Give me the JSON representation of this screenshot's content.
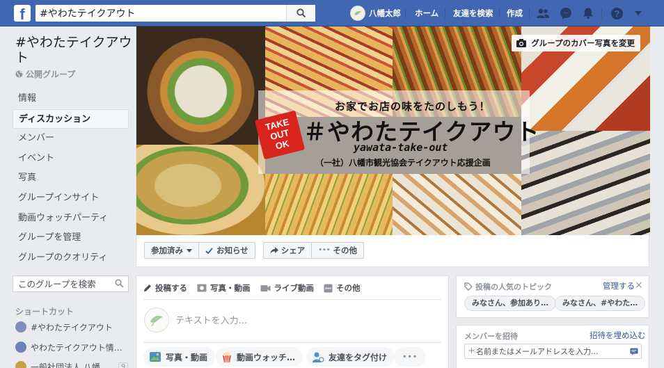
{
  "topbar": {
    "search_value": "#やわたテイクアウト",
    "user_name": "八幡太郎",
    "home": "ホーム",
    "find_friends": "友達を検索",
    "create": "作成"
  },
  "group": {
    "title": "#やわたテイクアウト",
    "type": "公開グループ"
  },
  "sidebar": {
    "items": [
      {
        "label": "情報"
      },
      {
        "label": "ディスカッション"
      },
      {
        "label": "メンバー"
      },
      {
        "label": "イベント"
      },
      {
        "label": "写真"
      },
      {
        "label": "グループインサイト"
      },
      {
        "label": "動画ウォッチパーティ"
      },
      {
        "label": "グループを管理"
      },
      {
        "label": "グループのクオリティ"
      }
    ],
    "search_placeholder": "このグループを検索",
    "shortcuts_title": "ショートカット",
    "shortcuts": [
      {
        "label": "#やわたテイクアウト"
      },
      {
        "label": "やわたテイクアウト情…"
      },
      {
        "label": "一般社団法人 八幡…",
        "count": "9"
      }
    ]
  },
  "cover": {
    "change_cover": "グループのカバー写真を変更",
    "badge": [
      "TAKE",
      "OUT",
      "OK"
    ],
    "tagline": "お家でお店の味をたのしもう！",
    "title": "＃やわたテイクアウト",
    "subtitle": "yawata-take-out",
    "org": "（一社）八幡市観光協会テイクアウト応援企画",
    "actions": {
      "joined": "参加済み",
      "notifications": "お知らせ",
      "share": "シェア",
      "more": "その他"
    }
  },
  "composer": {
    "tabs": {
      "post": "投稿する",
      "photo_video": "写真・動画",
      "live": "ライブ動画",
      "more": "その他"
    },
    "placeholder": "テキストを入力...",
    "pills": {
      "photo_video": "写真・動画",
      "watch_party": "動画ウォッチ…",
      "tag_friends": "友達をタグ付け",
      "more": "•••"
    }
  },
  "topics_card": {
    "title": "投稿の人気のトピック",
    "manage": "管理する",
    "close": "×",
    "topics": [
      "みなさん、参加あり…",
      "みなさん、#やわた…"
    ]
  },
  "invite_card": {
    "title": "メンバーを招待",
    "embed": "招待を埋め込む",
    "placeholder": "名前またはメールアドレスを入力..."
  },
  "colors": {
    "brand": "#4267b2",
    "badge_red": "#d9231d",
    "link": "#365899"
  }
}
